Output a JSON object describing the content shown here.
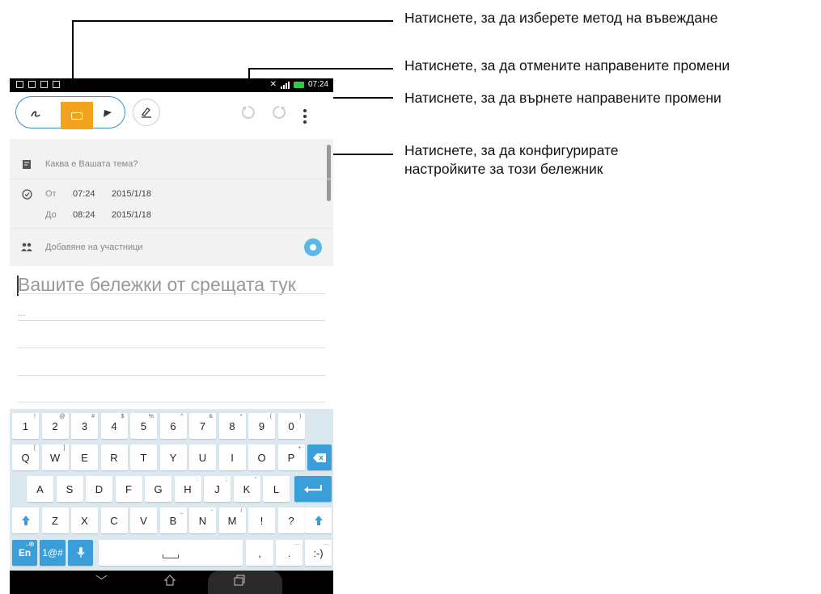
{
  "annotations": {
    "input_method": "Натиснете, за да изберете метод на въвеждане",
    "undo": "Натиснете, за да отмените направените промени",
    "redo": "Натиснете, за да върнете направените промени",
    "settings_line1": "Натиснете, за да конфигурирате",
    "settings_line2": "настройките за този бележник"
  },
  "status_bar": {
    "time": "07:24"
  },
  "form": {
    "topic_placeholder": "Каква е Вашата тема?",
    "from_label": "От",
    "from_time": "07:24",
    "from_date": "2015/1/18",
    "to_label": "До",
    "to_time": "08:24",
    "to_date": "2015/1/18",
    "participants_placeholder": "Добавяне на участници"
  },
  "notes": {
    "placeholder": "Вашите бележки от срещата тук",
    "ellipsis": "..."
  },
  "keyboard": {
    "row1": [
      "1",
      "2",
      "3",
      "4",
      "5",
      "6",
      "7",
      "8",
      "9",
      "0"
    ],
    "row1_sup": [
      "!",
      "@",
      "#",
      "$",
      "%",
      "^",
      "&",
      "*",
      "(",
      ")"
    ],
    "row2": [
      "Q",
      "W",
      "E",
      "R",
      "T",
      "Y",
      "U",
      "I",
      "O",
      "P"
    ],
    "row2_sup": [
      "[",
      "]",
      "",
      "",
      "",
      "",
      "",
      "",
      "",
      "+"
    ],
    "row3": [
      "A",
      "S",
      "D",
      "F",
      "G",
      "H",
      "J",
      "K",
      "L"
    ],
    "row3_sup": [
      "",
      "",
      "",
      "",
      "",
      ":",
      ";",
      "\"",
      ""
    ],
    "row4": [
      "Z",
      "X",
      "C",
      "V",
      "B",
      "N",
      "M",
      "!",
      "?"
    ],
    "row4_sup": [
      "",
      "",
      "",
      "",
      "_",
      "-",
      "/",
      "",
      ""
    ],
    "lang": "En",
    "symbols": "1@#",
    "comma": ",",
    "period": ".",
    "smiley": ":-)"
  }
}
